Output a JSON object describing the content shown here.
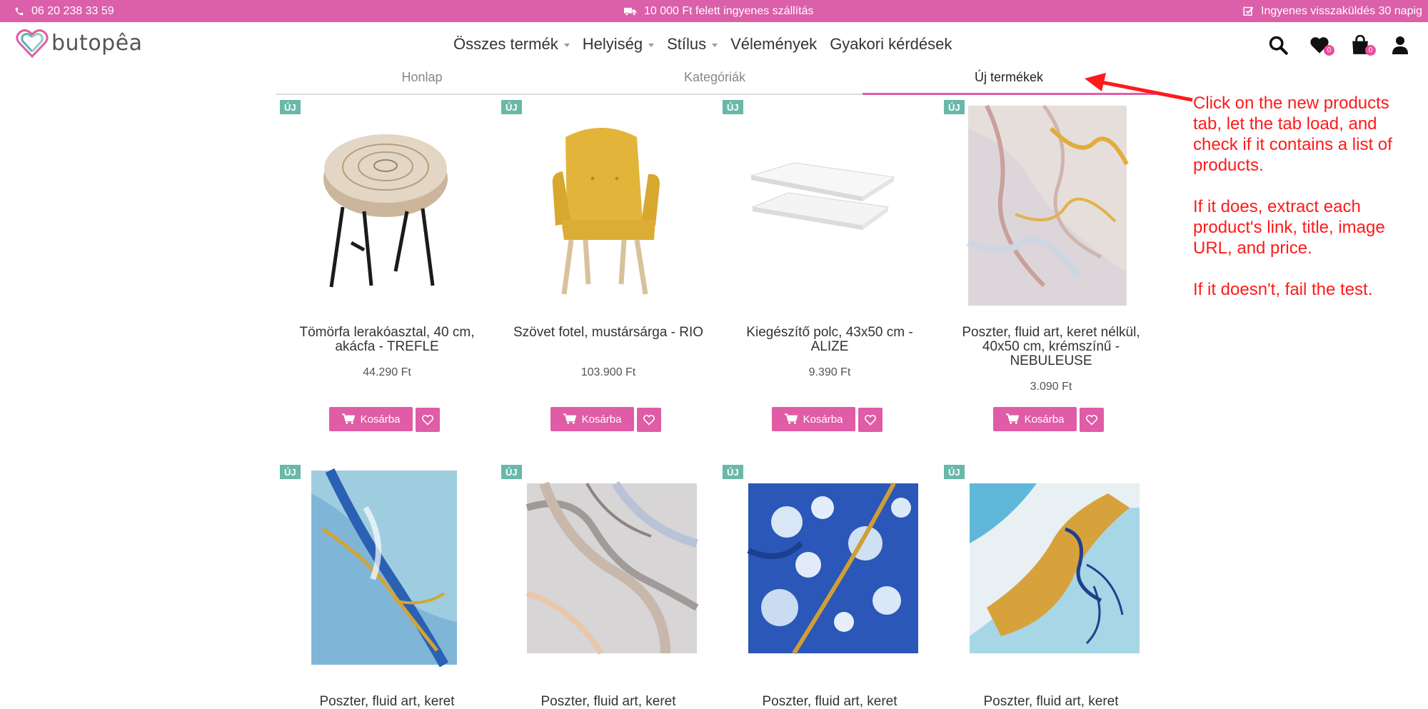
{
  "topbar": {
    "phone": "06 20 238 33 59",
    "shipping": "10 000 Ft felett ingyenes szállítás",
    "returns": "Ingyenes visszaküldés 30 napig",
    "color": "#db5fa9"
  },
  "logo": {
    "text": "butopêa"
  },
  "nav": {
    "items": [
      {
        "label": "Összes termék",
        "dropdown": true
      },
      {
        "label": "Helyiség",
        "dropdown": true
      },
      {
        "label": "Stílus",
        "dropdown": true
      },
      {
        "label": "Vélemények",
        "dropdown": false
      },
      {
        "label": "Gyakori kérdések",
        "dropdown": false
      }
    ]
  },
  "header_icons": {
    "wishlist_count": "0",
    "cart_count": "0"
  },
  "tabs": [
    {
      "label": "Honlap",
      "active": false
    },
    {
      "label": "Kategóriák",
      "active": false
    },
    {
      "label": "Új termékek",
      "active": true
    }
  ],
  "products": [
    {
      "badge": "ÚJ",
      "title": "Tömörfa lerakóasztal, 40 cm, akácfa - TREFLE",
      "price": "44.290 Ft",
      "cart_label": "Kosárba",
      "image": "wood-stool"
    },
    {
      "badge": "ÚJ",
      "title": "Szövet fotel, mustársárga - RIO",
      "price": "103.900 Ft",
      "cart_label": "Kosárba",
      "image": "yellow-armchair"
    },
    {
      "badge": "ÚJ",
      "title": "Kiegészítő polc, 43x50 cm - ALIZE",
      "price": "9.390 Ft",
      "cart_label": "Kosárba",
      "image": "white-shelves"
    },
    {
      "badge": "ÚJ",
      "title": "Poszter, fluid art, keret nélkül, 40x50 cm, krémszínű - NEBULEUSE",
      "price": "3.090 Ft",
      "cart_label": "Kosárba",
      "image": "cream-fluid-art"
    },
    {
      "badge": "ÚJ",
      "title": "Poszter, fluid art, keret",
      "image": "blue-gold-fluid-art"
    },
    {
      "badge": "ÚJ",
      "title": "Poszter, fluid art, keret",
      "image": "grey-marble-fluid-art"
    },
    {
      "badge": "ÚJ",
      "title": "Poszter, fluid art, keret",
      "image": "blue-cells-fluid-art"
    },
    {
      "badge": "ÚJ",
      "title": "Poszter, fluid art, keret",
      "image": "gold-blue-fluid-art"
    }
  ],
  "annotation": {
    "lines": [
      "Click on the new products tab, let the tab load, and check if it contains a list of products.",
      "If it does, extract each product's link, title, image URL, and price.",
      "If it doesn't, fail the test."
    ],
    "color": "#ff1a1a"
  }
}
